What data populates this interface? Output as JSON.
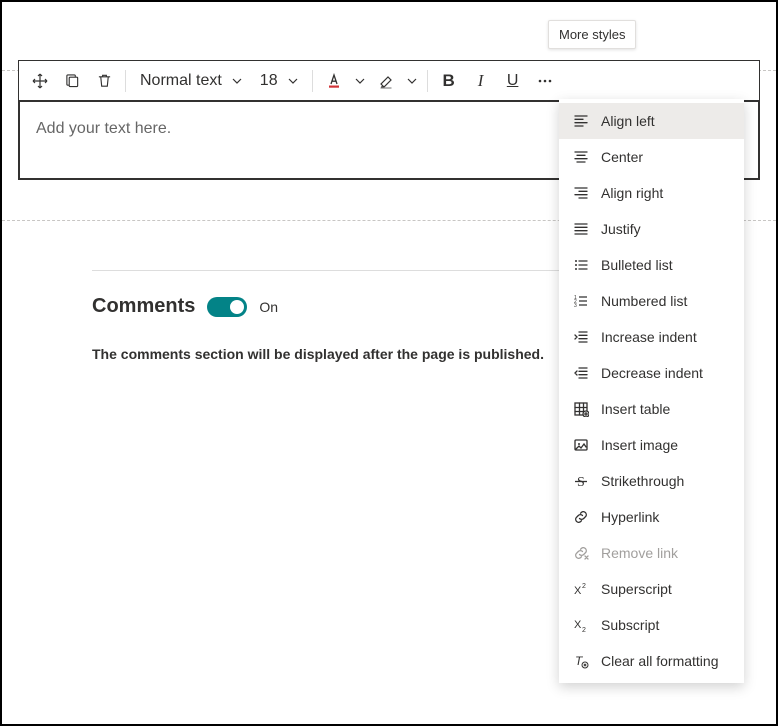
{
  "tooltip": {
    "text": "More styles"
  },
  "toolbar": {
    "paragraph_style": "Normal text",
    "font_size": "18"
  },
  "editor": {
    "placeholder": "Add your text here."
  },
  "comments": {
    "heading": "Comments",
    "toggle_state": "On",
    "message": "The comments section will be displayed after the page is published."
  },
  "menu": {
    "items": [
      {
        "label": "Align left",
        "disabled": false,
        "hover": true
      },
      {
        "label": "Center",
        "disabled": false,
        "hover": false
      },
      {
        "label": "Align right",
        "disabled": false,
        "hover": false
      },
      {
        "label": "Justify",
        "disabled": false,
        "hover": false
      },
      {
        "label": "Bulleted list",
        "disabled": false,
        "hover": false
      },
      {
        "label": "Numbered list",
        "disabled": false,
        "hover": false
      },
      {
        "label": "Increase indent",
        "disabled": false,
        "hover": false
      },
      {
        "label": "Decrease indent",
        "disabled": false,
        "hover": false
      },
      {
        "label": "Insert table",
        "disabled": false,
        "hover": false
      },
      {
        "label": "Insert image",
        "disabled": false,
        "hover": false
      },
      {
        "label": "Strikethrough",
        "disabled": false,
        "hover": false
      },
      {
        "label": "Hyperlink",
        "disabled": false,
        "hover": false
      },
      {
        "label": "Remove link",
        "disabled": true,
        "hover": false
      },
      {
        "label": "Superscript",
        "disabled": false,
        "hover": false
      },
      {
        "label": "Subscript",
        "disabled": false,
        "hover": false
      },
      {
        "label": "Clear all formatting",
        "disabled": false,
        "hover": false
      }
    ]
  }
}
